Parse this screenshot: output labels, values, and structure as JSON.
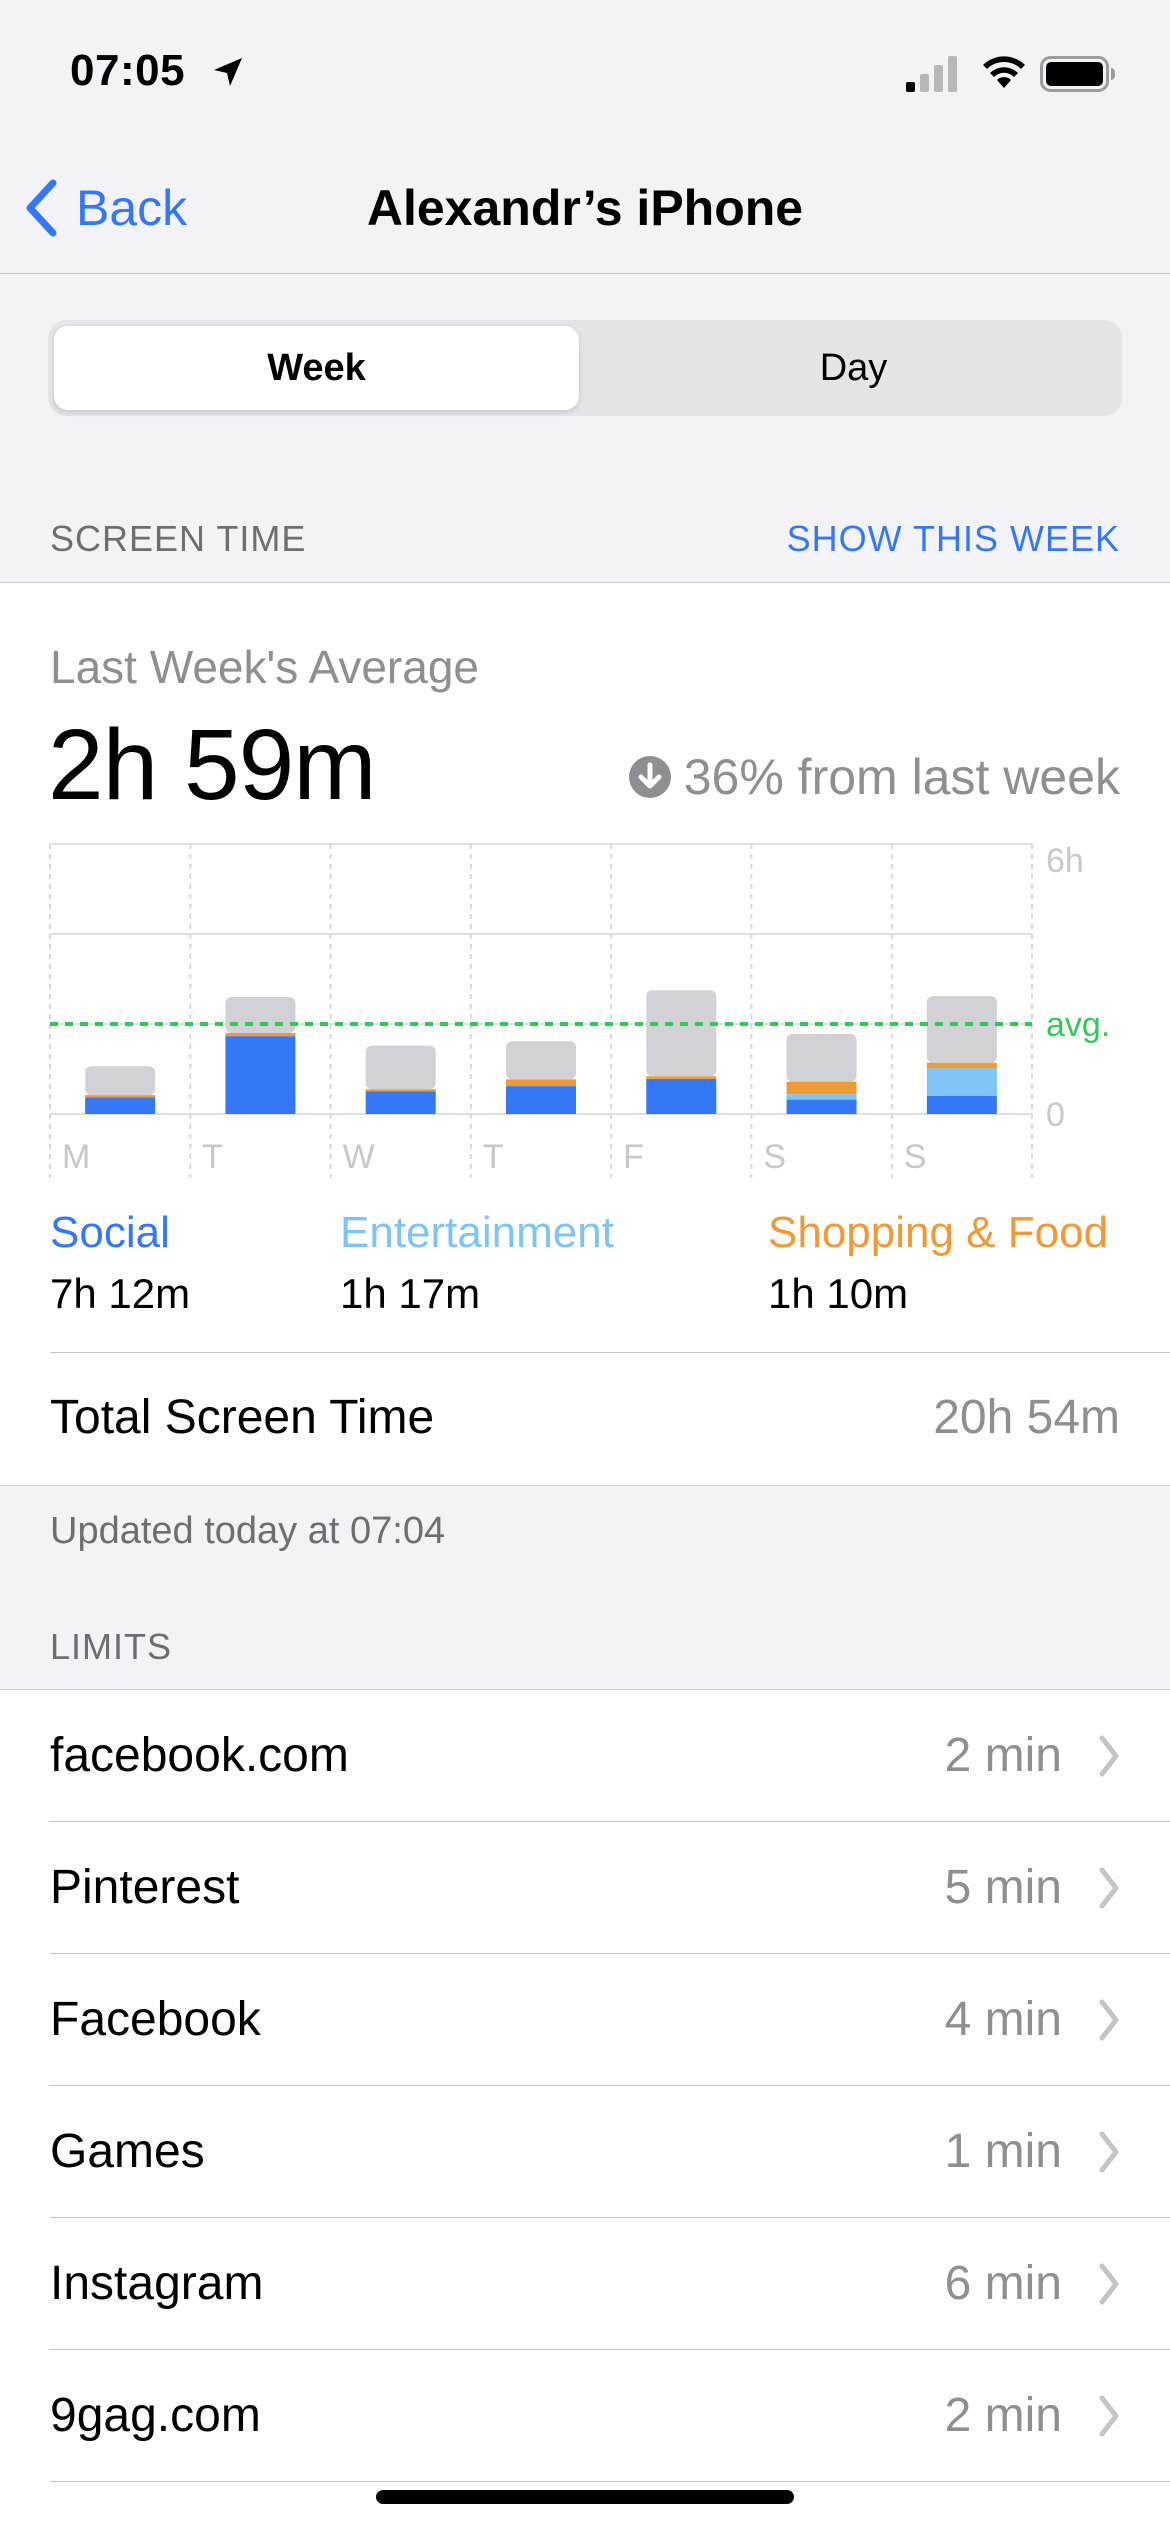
{
  "status_bar": {
    "time": "07:05"
  },
  "nav": {
    "back_label": "Back",
    "title": "Alexandr’s iPhone"
  },
  "segmented": {
    "options": [
      "Week",
      "Day"
    ],
    "selected": "Week"
  },
  "screen_time_section": {
    "header": "SCREEN TIME",
    "action": "SHOW THIS WEEK"
  },
  "summary": {
    "average_label": "Last Week's Average",
    "average_value": "2h 59m",
    "change_text": "36% from last week",
    "change_direction": "down"
  },
  "chart_data": {
    "type": "bar",
    "stacked": true,
    "categories": [
      "M",
      "T",
      "W",
      "T",
      "F",
      "S",
      "S"
    ],
    "series": [
      {
        "name": "Social",
        "color": "#3478f6",
        "values": [
          0.37,
          1.73,
          0.5,
          0.62,
          0.78,
          0.32,
          0.4
        ]
      },
      {
        "name": "Entertainment",
        "color": "#7ec4f5",
        "values": [
          0,
          0,
          0,
          0,
          0,
          0.12,
          0.62
        ]
      },
      {
        "name": "Shopping & Food",
        "color": "#f09a37",
        "values": [
          0.05,
          0.07,
          0.05,
          0.15,
          0.06,
          0.28,
          0.12
        ]
      },
      {
        "name": "Other",
        "color": "#d1d1d6",
        "values": [
          0.64,
          0.8,
          0.97,
          0.85,
          1.91,
          1.06,
          1.48
        ]
      }
    ],
    "average": 2.0,
    "ylim": [
      0,
      6
    ],
    "y_tick_labels": {
      "max": "6h",
      "avg": "avg.",
      "min": "0"
    },
    "avg_color": "#34c759"
  },
  "legend": [
    {
      "label": "Social",
      "value": "7h 12m",
      "color": "#3478f6"
    },
    {
      "label": "Entertainment",
      "value": "1h 17m",
      "color": "#7ec4f5"
    },
    {
      "label": "Shopping & Food",
      "value": "1h 10m",
      "color": "#f09a37"
    }
  ],
  "total": {
    "label": "Total Screen Time",
    "value": "20h 54m"
  },
  "updated_text": "Updated today at 07:04",
  "limits": {
    "header": "LIMITS",
    "items": [
      {
        "name": "facebook.com",
        "value": "2 min"
      },
      {
        "name": "Pinterest",
        "value": "5 min"
      },
      {
        "name": "Facebook",
        "value": "4 min"
      },
      {
        "name": "Games",
        "value": "1 min"
      },
      {
        "name": "Instagram",
        "value": "6 min"
      },
      {
        "name": "9gag.com",
        "value": "2 min"
      }
    ]
  }
}
